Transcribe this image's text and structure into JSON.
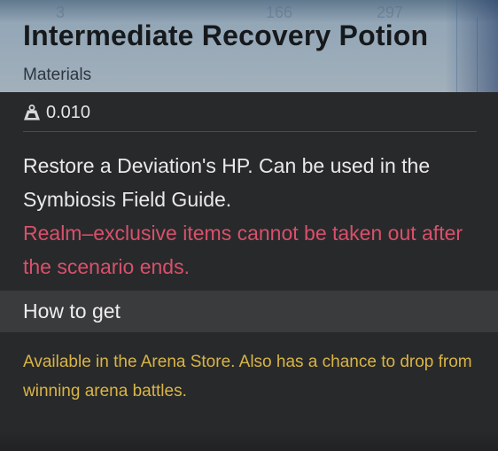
{
  "header": {
    "ghost_numbers": [
      "3",
      "166",
      "297"
    ],
    "title": "Intermediate Recovery Potion",
    "category": "Materials",
    "background_color": "#97a9b8"
  },
  "weight": {
    "icon": "weight-icon",
    "value": "0.010"
  },
  "description": {
    "text": "Restore a Deviation's HP. Can be used in the Symbiosis Field Guide.",
    "warning": "Realm–exclusive items cannot be taken out after the scenario ends.",
    "warning_color": "#d9506b"
  },
  "how_to_get": {
    "title": "How to get",
    "text": "Available in the Arena Store. Also has a chance to drop from winning arena battles.",
    "text_color": "#d9b545"
  }
}
